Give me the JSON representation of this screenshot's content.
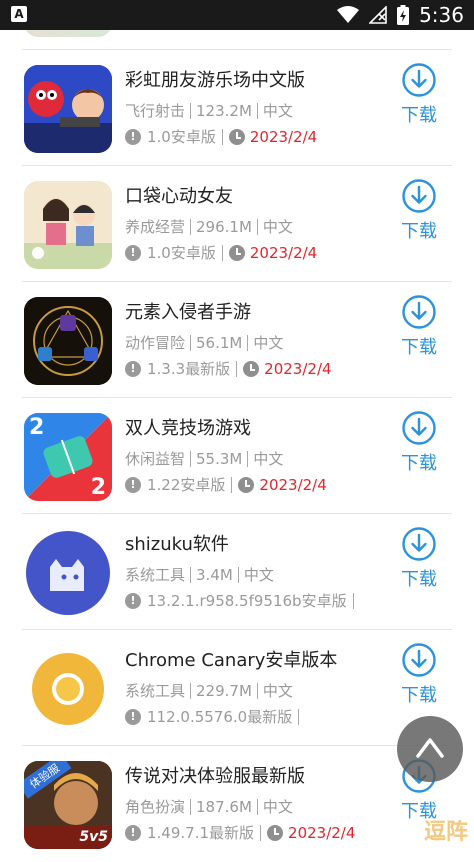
{
  "status_bar": {
    "time": "5:36",
    "app_icon": "A"
  },
  "apps": [
    {
      "title": "彩虹朋友游乐场中文版",
      "category": "飞行射击",
      "size": "123.2M",
      "lang": "中文",
      "version": "1.0安卓版",
      "date": "2023/2/4",
      "download": "下载"
    },
    {
      "title": "口袋心动女友",
      "category": "养成经营",
      "size": "296.1M",
      "lang": "中文",
      "version": "1.0安卓版",
      "date": "2023/2/4",
      "download": "下载"
    },
    {
      "title": "元素入侵者手游",
      "category": "动作冒险",
      "size": "56.1M",
      "lang": "中文",
      "version": "1.3.3最新版",
      "date": "2023/2/4",
      "download": "下载"
    },
    {
      "title": "双人竞技场游戏",
      "category": "休闲益智",
      "size": "55.3M",
      "lang": "中文",
      "version": "1.22安卓版",
      "date": "2023/2/4",
      "download": "下载"
    },
    {
      "title": "shizuku软件",
      "category": "系统工具",
      "size": "3.4M",
      "lang": "中文",
      "version": "13.2.1.r958.5f9516b安卓版",
      "date": "",
      "download": "下载"
    },
    {
      "title": "Chrome Canary安卓版本",
      "category": "系统工具",
      "size": "229.7M",
      "lang": "中文",
      "version": "112.0.5576.0最新版",
      "date": "",
      "download": "下载"
    },
    {
      "title": "传说对决体验服最新版",
      "category": "角色扮演",
      "size": "187.6M",
      "lang": "中文",
      "version": "1.49.7.1最新版",
      "date": "2023/2/4",
      "download": "下载"
    }
  ],
  "thumb_text": {
    "duel_left": "2",
    "duel_right": "2",
    "aov_badge": "体验服",
    "aov_mode": "5v5"
  },
  "watermark": "逗阵",
  "colors": {
    "accent": "#2a92df",
    "date": "#e0262d"
  },
  "icons": {
    "download": "download-circle-icon",
    "fab": "chevron-up-icon"
  }
}
